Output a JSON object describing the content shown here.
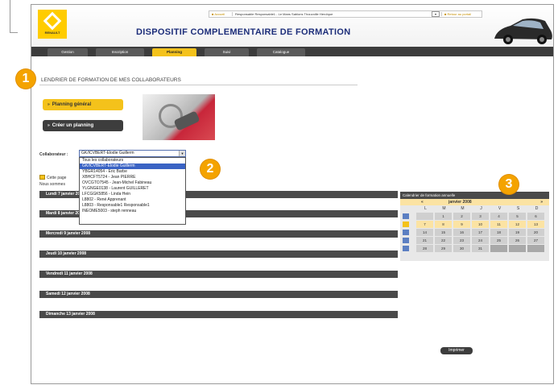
{
  "brand": {
    "logo_text": "RENAULT",
    "accent": "#f4c21b",
    "title_color": "#1d2e7a"
  },
  "header": {
    "title": "DISPOSITIF COMPLEMENTAIRE DE FORMATION",
    "home_link": "Accueil",
    "user_info": "Responsable Responsable1 - Le Mans Sablons Thouvoille Heroïque",
    "print_link": "Retour au portail"
  },
  "tabs": [
    {
      "label": "Gestion"
    },
    {
      "label": "Inscription"
    },
    {
      "label": "Planning"
    },
    {
      "label": "Suivi"
    },
    {
      "label": "Catalogue"
    }
  ],
  "main": {
    "section_heading": "LENDRIER DE FORMATION DE MES COLLABORATEURS",
    "btn_planning": "Planning général",
    "btn_create": "Créer un planning",
    "collab_label": "Collaborateur",
    "collab_value": "GK/ICVBERT-Elodie Guillerm",
    "dropdown_options": [
      "Tous les collaborateurs",
      "GK/ICVBERT-Elodie Guillerm",
      "YBGR14054 - Eric Barbe",
      "XBHCFT5724 - Jean PIERRE",
      "OVCGTO7545 - Jean-Michel Fabineau",
      "YLGNGE0138 - Laurent GUILLERET",
      "LFCGGK5856 - Linda Hein",
      "L8802 - René Apprenant",
      "L8803 - Responsable1 Responsable1",
      "INEOME5003 - steph renneau"
    ],
    "info_text_1": "Cette page",
    "info_text_2": "Nous sommes",
    "days": [
      "Lundi 7 janvier 2008",
      "Mardi 8 janvier 2008",
      "Mercredi 9 janvier 2008",
      "Jeudi 10 janvier 2008",
      "Vendredi 11 janvier 2008",
      "Samedi 12 janvier 2008",
      "Dimanche 13 janvier 2008"
    ],
    "print_btn": "Imprimer"
  },
  "calendar": {
    "header": "Calendrier de formation annuelle",
    "month": "janvier 2008",
    "nav_prev": "«",
    "nav_next": "»",
    "dows": [
      "L",
      "M",
      "M",
      "J",
      "V",
      "S",
      "D"
    ],
    "rows": [
      [
        "",
        "1",
        "2",
        "3",
        "4",
        "5",
        "6"
      ],
      [
        "7",
        "8",
        "9",
        "10",
        "11",
        "12",
        "13"
      ],
      [
        "14",
        "15",
        "16",
        "17",
        "18",
        "19",
        "20"
      ],
      [
        "21",
        "22",
        "23",
        "24",
        "25",
        "26",
        "27"
      ],
      [
        "28",
        "29",
        "30",
        "31",
        "",
        "",
        ""
      ]
    ]
  },
  "callouts": [
    "1",
    "2",
    "3"
  ]
}
